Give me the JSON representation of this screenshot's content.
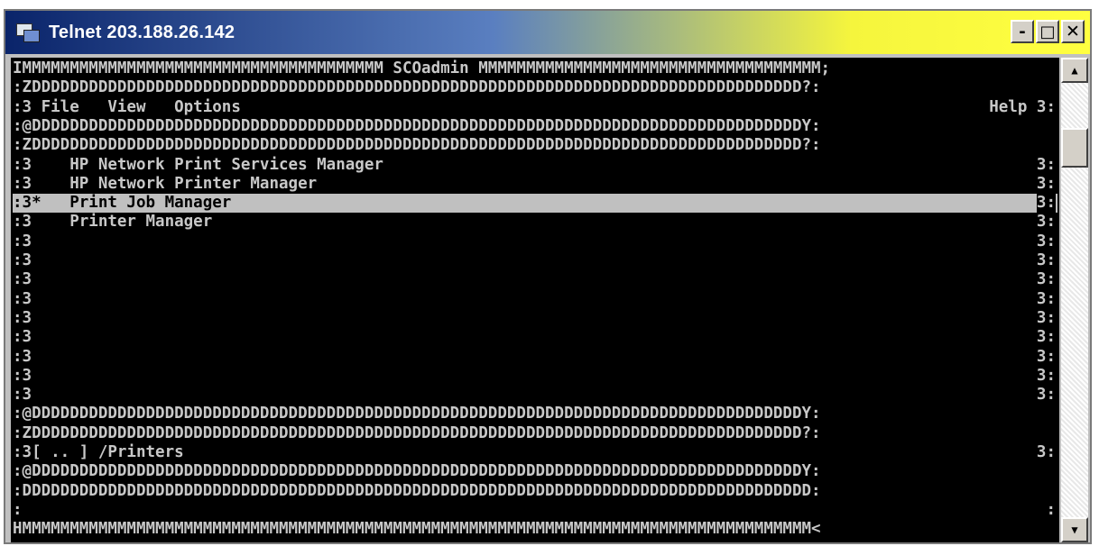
{
  "window": {
    "title": "Telnet 203.188.26.142",
    "buttons": {
      "minimize": "-",
      "maximize": "□",
      "close": "✕"
    }
  },
  "terminal": {
    "lines": [
      "IMMMMMMMMMMMMMMMMMMMMMMMMMMMMMMMMMMMMMM SCOadmin MMMMMMMMMMMMMMMMMMMMMMMMMMMMMMMMMMMM;",
      ":ZDDDDDDDDDDDDDDDDDDDDDDDDDDDDDDDDDDDDDDDDDDDDDDDDDDDDDDDDDDDDDDDDDDDDDDDDDDDDDDDDD?:",
      ":3 File   View   Options",
      ":@DDDDDDDDDDDDDDDDDDDDDDDDDDDDDDDDDDDDDDDDDDDDDDDDDDDDDDDDDDDDDDDDDDDDDDDDDDDDDDDDDY:",
      ":ZDDDDDDDDDDDDDDDDDDDDDDDDDDDDDDDDDDDDDDDDDDDDDDDDDDDDDDDDDDDDDDDDDDDDDDDDDDDDDDDDD?:",
      ":3    HP Network Print Services Manager",
      ":3    HP Network Printer Manager",
      ":3*   Print Job Manager",
      ":3    Printer Manager",
      ":3",
      ":3",
      ":3",
      ":3",
      ":3",
      ":3",
      ":3",
      ":3",
      ":3",
      ":@DDDDDDDDDDDDDDDDDDDDDDDDDDDDDDDDDDDDDDDDDDDDDDDDDDDDDDDDDDDDDDDDDDDDDDDDDDDDDDDDDY:",
      ":ZDDDDDDDDDDDDDDDDDDDDDDDDDDDDDDDDDDDDDDDDDDDDDDDDDDDDDDDDDDDDDDDDDDDDDDDDDDDDDDDDD?:",
      ":3[ .. ] /Printers",
      ":@DDDDDDDDDDDDDDDDDDDDDDDDDDDDDDDDDDDDDDDDDDDDDDDDDDDDDDDDDDDDDDDDDDDDDDDDDDDDDDDDDY:",
      ":DDDDDDDDDDDDDDDDDDDDDDDDDDDDDDDDDDDDDDDDDDDDDDDDDDDDDDDDDDDDDDDDDDDDDDDDDDDDDDDDDDD:",
      ":",
      "HMMMMMMMMMMMMMMMMMMMMMMMMMMMMMMMMMMMMMMMMMMMMMMMMMMMMMMMMMMMMMMMMMMMMMMMMMMMMMMMMMMM<"
    ],
    "right_edge": {
      "2": "Help 3:",
      "5": "3:",
      "6": "3:",
      "7": "3:",
      "8": "3:",
      "9": "3:",
      "10": "3:",
      "11": "3:",
      "12": "3:",
      "13": "3:",
      "14": "3:",
      "15": "3:",
      "16": "3:",
      "17": "3:",
      "20": "3:",
      "23": ":"
    },
    "highlighted_line": 7
  },
  "scrollbar": {
    "up_arrow": "▲",
    "down_arrow": "▼"
  }
}
